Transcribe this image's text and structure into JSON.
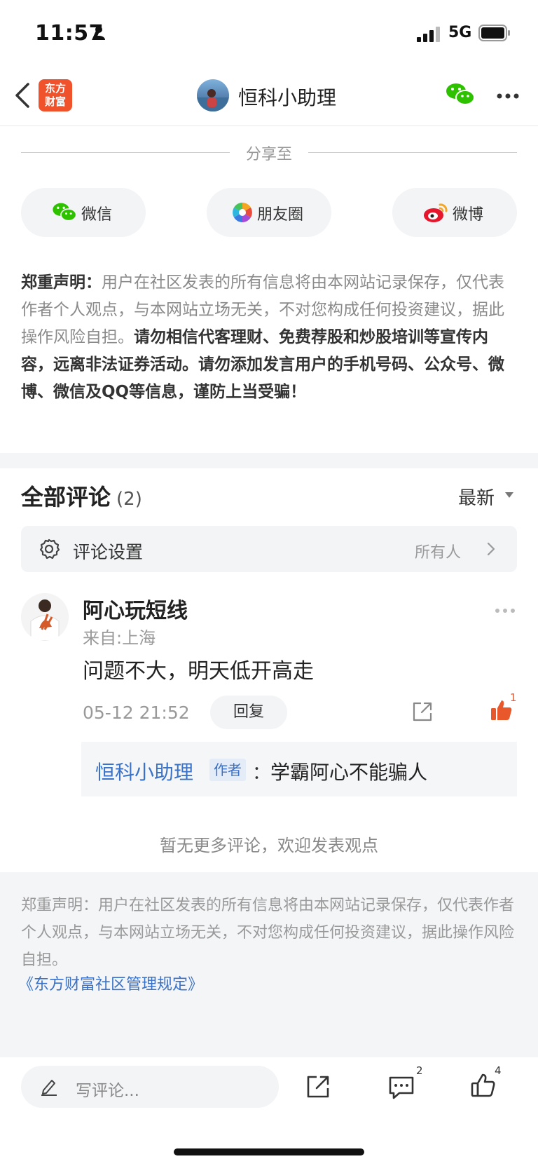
{
  "status_bar": {
    "time": "11:57",
    "network": "5G"
  },
  "nav": {
    "logo_line1": "东方",
    "logo_line2": "财富",
    "title": "恒科小助理"
  },
  "share": {
    "label": "分享至",
    "buttons": [
      {
        "label": "微信",
        "icon": "wechat-icon"
      },
      {
        "label": "朋友圈",
        "icon": "moments-icon"
      },
      {
        "label": "微博",
        "icon": "weibo-icon"
      }
    ]
  },
  "disclaimer": {
    "prefix": "郑重声明：",
    "normal": "用户在社区发表的所有信息将由本网站记录保存，仅代表作者个人观点，与本网站立场无关，不对您构成任何投资建议，据此操作风险自担。",
    "strong": "请勿相信代客理财、免费荐股和炒股培训等宣传内容，远离非法证券活动。请勿添加发言用户的手机号码、公众号、微博、微信及QQ等信息，谨防上当受骗！"
  },
  "comments": {
    "title": "全部评论",
    "count": "(2)",
    "sort_label": "最新",
    "settings_label": "评论设置",
    "settings_value": "所有人",
    "items": [
      {
        "user": "阿心玩短线",
        "location": "来自:上海",
        "text": "问题不大，明天低开高走",
        "time": "05-12 21:52",
        "reply_label": "回复",
        "like_count": "1",
        "replies": [
          {
            "author": "恒科小助理",
            "tag": "作者",
            "colon": "：",
            "text": "学霸阿心不能骗人"
          }
        ]
      }
    ],
    "no_more": "暂无更多评论，欢迎发表观点"
  },
  "footer": {
    "text": "郑重声明：用户在社区发表的所有信息将由本网站记录保存，仅代表作者个人观点，与本网站立场无关，不对您构成任何投资建议，据此操作风险自担。",
    "link": "《东方财富社区管理规定》"
  },
  "bottom_bar": {
    "input_placeholder": "写评论...",
    "comment_count": "2",
    "like_count": "4"
  },
  "colors": {
    "brand": "#f0522c",
    "link": "#3a72c8",
    "like": "#e8582b",
    "wechat": "#2dc100"
  }
}
